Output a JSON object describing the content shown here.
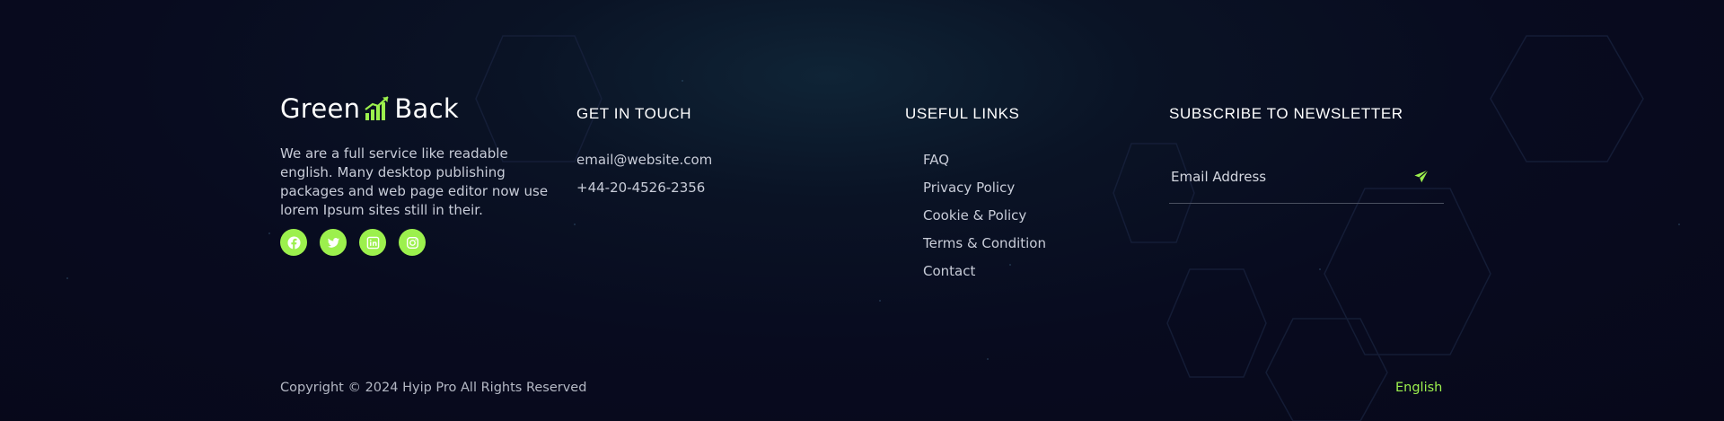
{
  "brand": {
    "name_left": "Green",
    "name_right": "Back",
    "accent": "#9cf04d"
  },
  "about": "We are a full service like readable english. Many desktop publishing packages and web page editor now use lorem Ipsum sites still in their.",
  "social_icons": [
    "facebook-icon",
    "twitter-icon",
    "linkedin-icon",
    "instagram-icon"
  ],
  "contact": {
    "title": "GET IN TOUCH",
    "email": "email@website.com",
    "phone": "+44-20-4526-2356"
  },
  "useful_links": {
    "title": "USEFUL LINKS",
    "items": [
      "FAQ",
      "Privacy Policy",
      "Cookie & Policy",
      "Terms & Condition",
      "Contact"
    ]
  },
  "newsletter": {
    "title": "SUBSCRIBE TO NEWSLETTER",
    "placeholder": "Email Address",
    "send_icon": "send-icon"
  },
  "footer": {
    "copyright": "Copyright © 2024 Hyip Pro All Rights Reserved",
    "language": "English"
  }
}
